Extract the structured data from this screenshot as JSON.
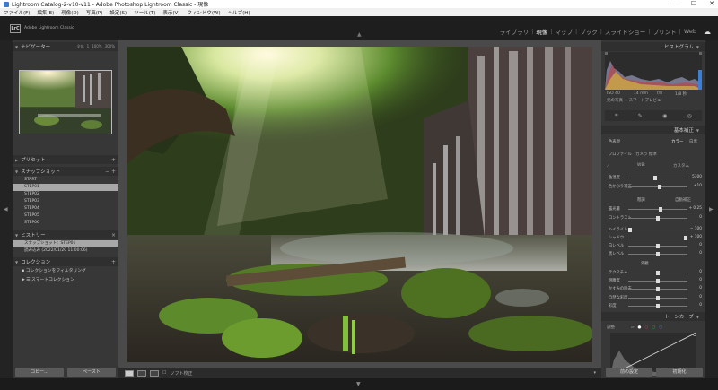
{
  "window": {
    "title": "Lightroom Catalog-2-v10-v11 - Adobe Photoshop Lightroom Classic - 現像",
    "minimize": "—",
    "maximize": "☐",
    "close": "✕"
  },
  "menu": [
    "ファイル(F)",
    "編集(E)",
    "現像(D)",
    "写真(P)",
    "設定(S)",
    "ツール(T)",
    "表示(V)",
    "ウィンドウ(W)",
    "ヘルプ(H)"
  ],
  "identity": {
    "logo": "LrC",
    "app_name": "Adobe Lightroom Classic"
  },
  "modules": [
    {
      "label": "ライブラリ",
      "active": false
    },
    {
      "label": "現像",
      "active": true
    },
    {
      "label": "マップ",
      "active": false
    },
    {
      "label": "ブック",
      "active": false
    },
    {
      "label": "スライドショー",
      "active": false
    },
    {
      "label": "プリント",
      "active": false
    },
    {
      "label": "Web",
      "active": false
    }
  ],
  "left": {
    "navigator": {
      "title": "ナビゲーター",
      "zooms": [
        "全体",
        "1",
        "100%",
        "300%"
      ]
    },
    "presets": {
      "title": "プリセット"
    },
    "snapshots": {
      "title": "スナップショット",
      "items": [
        {
          "label": "START",
          "selected": false
        },
        {
          "label": "STEP01",
          "selected": true
        },
        {
          "label": "STEP02",
          "selected": false
        },
        {
          "label": "STEP03",
          "selected": false
        },
        {
          "label": "STEP04",
          "selected": false
        },
        {
          "label": "STEP05",
          "selected": false
        },
        {
          "label": "STEP06",
          "selected": false
        }
      ]
    },
    "history": {
      "title": "ヒストリー",
      "items": [
        {
          "label": "スナップショット：STEP01",
          "selected": true
        },
        {
          "label": "読み込み (2022/01/20 11:00:06)",
          "selected": false
        }
      ]
    },
    "collections": {
      "title": "コレクション",
      "items": [
        "コレクションをフィルタリング",
        "スマートコレクション"
      ]
    },
    "copy_label": "コピー...",
    "paste_label": "ペースト"
  },
  "toolbar": {
    "softproof": "ソフト校正"
  },
  "right": {
    "histogram": {
      "title": "ヒストグラム",
      "exif": [
        "ISO 40",
        "14 mm",
        "f/8",
        "1/8 秒"
      ],
      "preview": "元の写真 + スマートプレビュー"
    },
    "basic": {
      "title": "基本補正",
      "treatment_label": "色表現",
      "treatment_value": "カラー",
      "treatment_alt": "白黒",
      "profile_label": "プロファイル",
      "profile_value": "カメラ 標準",
      "wb_label": "WB:",
      "wb_value": "カスタム",
      "tone_label": "階調",
      "tone_auto": "自動補正",
      "presence_label": "外観",
      "sliders": [
        {
          "label": "色温度",
          "value": "5300",
          "pos": 0.45
        },
        {
          "label": "色かぶり補正",
          "value": "+10",
          "pos": 0.52
        },
        {
          "label": "露光量",
          "value": "+ 0.25",
          "pos": 0.53
        },
        {
          "label": "コントラスト",
          "value": "0",
          "pos": 0.5
        },
        {
          "label": "ハイライト",
          "value": "− 100",
          "pos": 0.0
        },
        {
          "label": "シャドウ",
          "value": "+ 100",
          "pos": 1.0
        },
        {
          "label": "白レベル",
          "value": "0",
          "pos": 0.5
        },
        {
          "label": "黒レベル",
          "value": "0",
          "pos": 0.5
        },
        {
          "label": "テクスチャ",
          "value": "0",
          "pos": 0.5
        },
        {
          "label": "明瞭度",
          "value": "0",
          "pos": 0.5
        },
        {
          "label": "かすみの除去",
          "value": "0",
          "pos": 0.5
        },
        {
          "label": "自然な彩度",
          "value": "0",
          "pos": 0.5
        },
        {
          "label": "彩度",
          "value": "0",
          "pos": 0.5
        }
      ]
    },
    "tonecurve": {
      "title": "トーンカーブ",
      "adjust_label": "調整"
    },
    "prev_label": "前の設定",
    "reset_label": "初期化"
  }
}
